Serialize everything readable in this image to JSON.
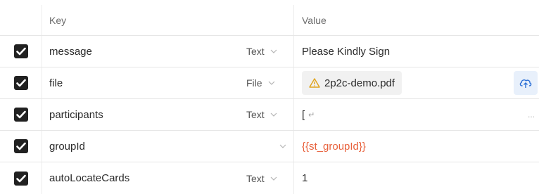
{
  "header": {
    "key": "Key",
    "value": "Value"
  },
  "rows": [
    {
      "key": "message",
      "type": "Text",
      "value": "Please Kindly Sign"
    },
    {
      "key": "file",
      "type": "File",
      "value": "2p2c-demo.pdf"
    },
    {
      "key": "participants",
      "type": "Text",
      "value": "[",
      "newline_glyph": "↵",
      "overflow": "..."
    },
    {
      "key": "groupId",
      "type": "",
      "value": "{{st_groupId}}"
    },
    {
      "key": "autoLocateCards",
      "type": "Text",
      "value": "1"
    }
  ],
  "colors": {
    "checkbox": "#212121",
    "variable": "#e8613c",
    "warning": "#e0a21a",
    "upload_icon": "#2b6fd6"
  }
}
